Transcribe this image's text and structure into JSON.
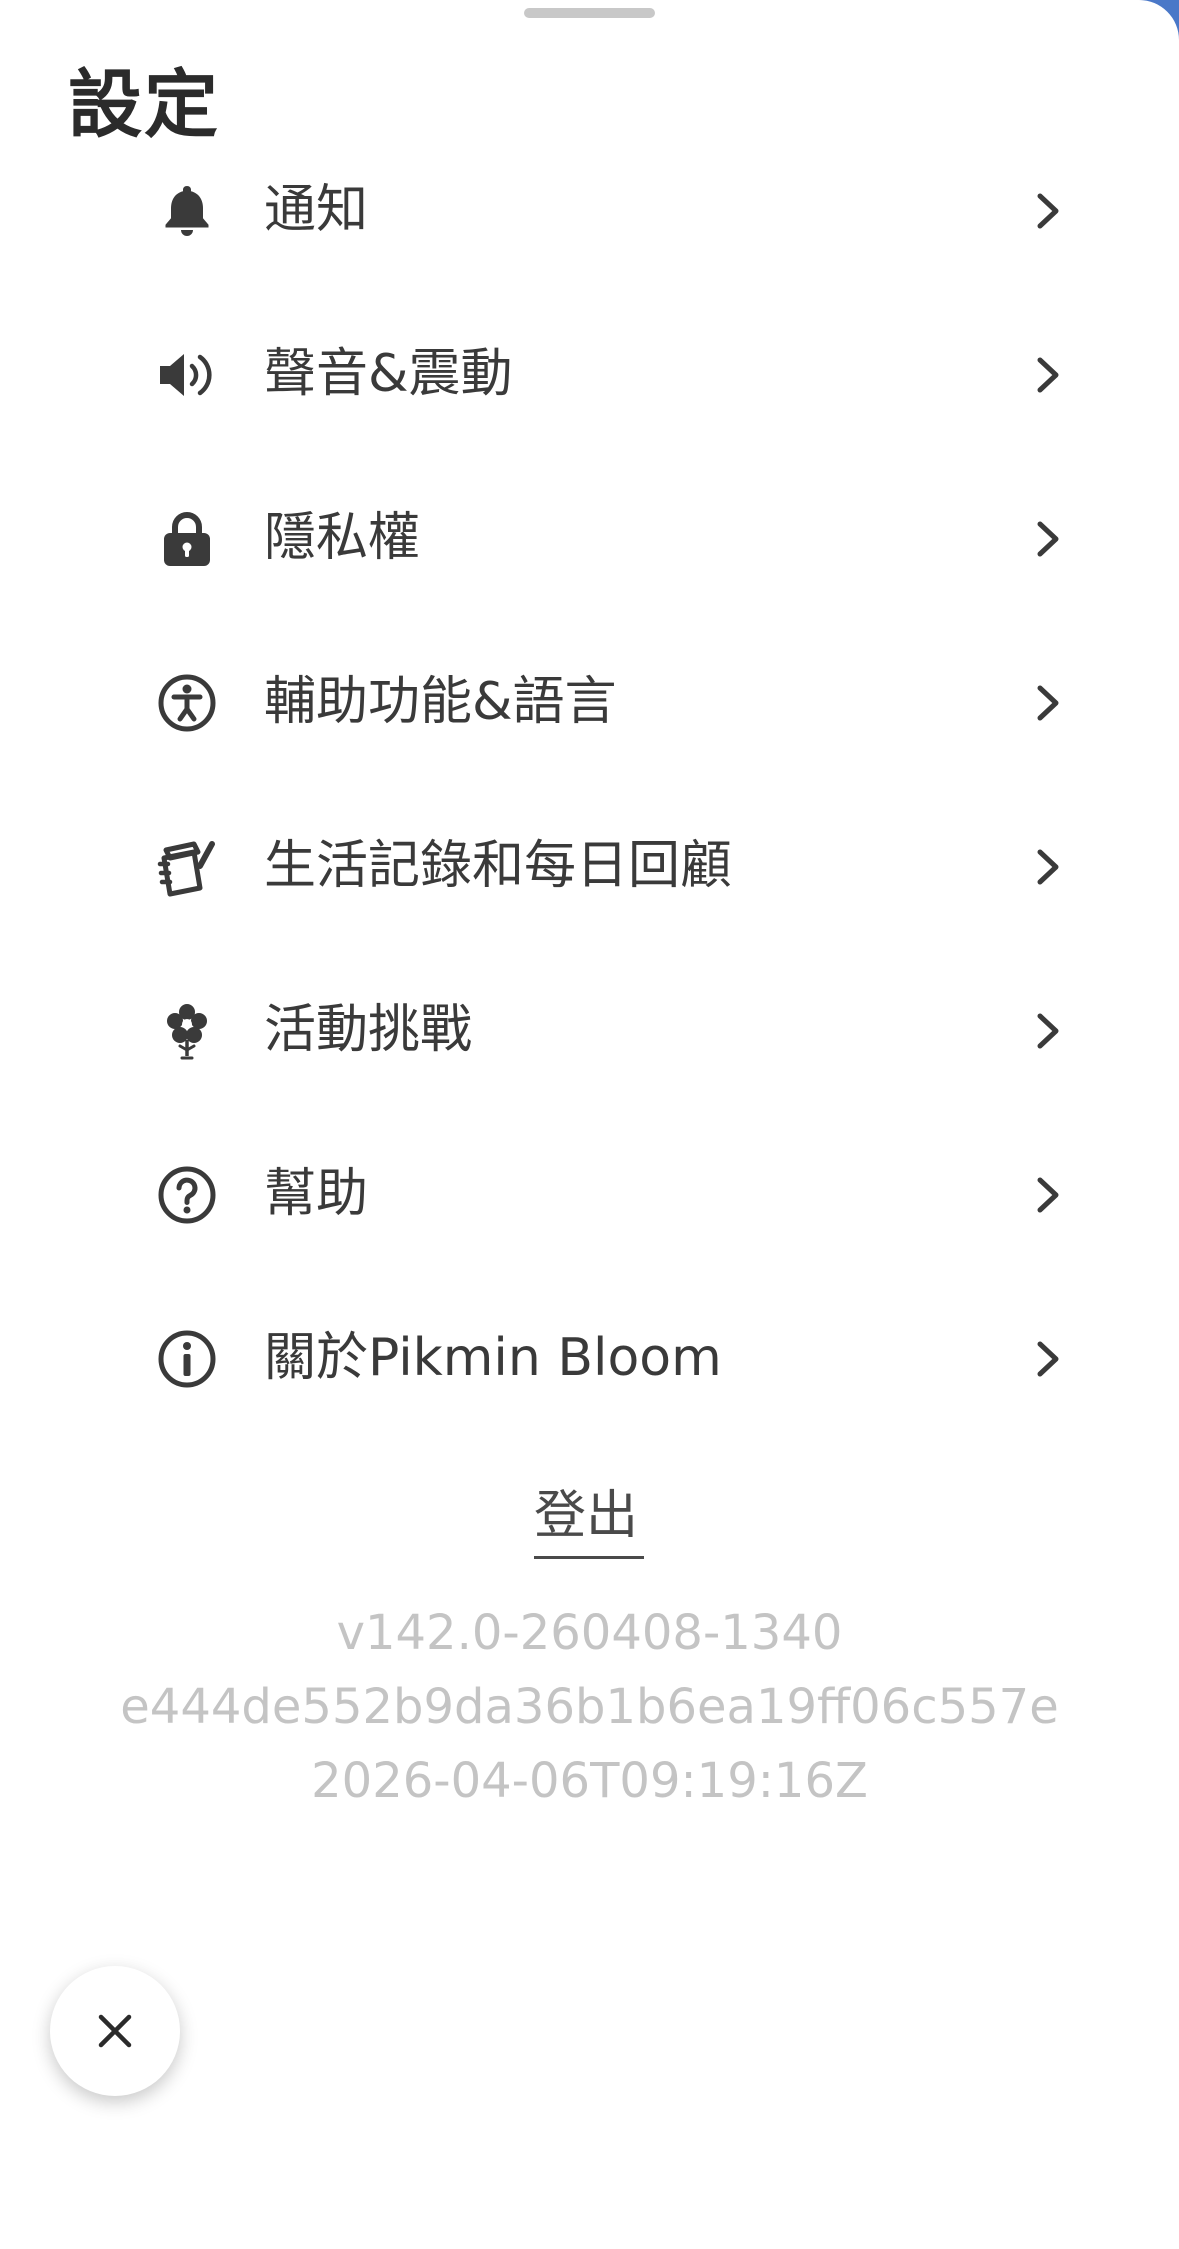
{
  "header": {
    "title": "設定"
  },
  "menu": {
    "items": [
      {
        "label": "通知",
        "icon": "bell-icon"
      },
      {
        "label": "聲音&震動",
        "icon": "speaker-icon"
      },
      {
        "label": "隱私權",
        "icon": "lock-icon"
      },
      {
        "label": "輔助功能&語言",
        "icon": "accessibility-icon"
      },
      {
        "label": "生活記錄和每日回顧",
        "icon": "journal-icon"
      },
      {
        "label": "活動挑戰",
        "icon": "flower-icon"
      },
      {
        "label": "幫助",
        "icon": "help-icon"
      },
      {
        "label": "關於Pikmin Bloom",
        "icon": "info-icon"
      }
    ]
  },
  "logout": {
    "label": "登出"
  },
  "version": {
    "line1": "v142.0-260408-1340",
    "line2": "e444de552b9da36b1b6ea19ff06c557e",
    "line3": "2026-04-06T09:19:16Z"
  },
  "colors": {
    "text": "#3a3a3a",
    "icon": "#3a3a3a",
    "muted": "#c4c4c4",
    "background": "#ffffff"
  }
}
